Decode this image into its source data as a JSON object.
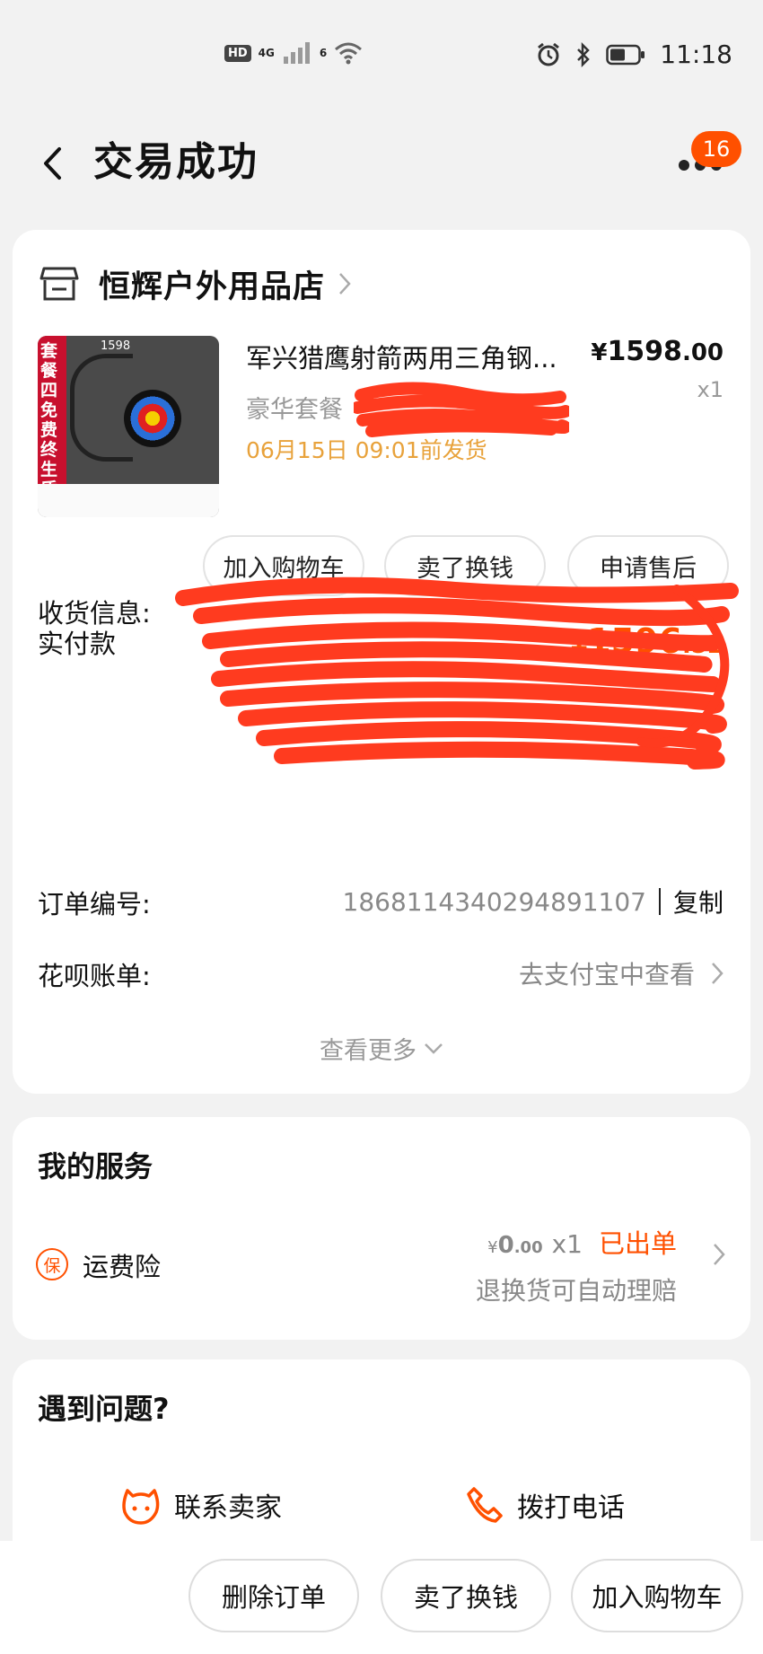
{
  "status_bar": {
    "hd": "HD",
    "net1": "4G",
    "net2": "6",
    "time": "11:18"
  },
  "nav": {
    "title": "交易成功",
    "badge": "16"
  },
  "shop": {
    "name": "恒辉户外用品店"
  },
  "product": {
    "title": "军兴猎鹰射箭两用三角钢...",
    "price_yen": "¥",
    "price_int": "1598",
    "price_dec": ".00",
    "qty": "x1",
    "spec": "豪华套餐",
    "ship": "06月15日 09:01前发货",
    "thumb_label": "套餐四免费终生质保",
    "thumb_price": "1598"
  },
  "actions": {
    "add_cart": "加入购物车",
    "sell": "卖了换钱",
    "after_sale": "申请售后"
  },
  "payment": {
    "label": "实付款",
    "yen": "¥",
    "int": "1596",
    "dec": ".52"
  },
  "shipping_info": {
    "label": "收货信息:"
  },
  "order": {
    "label": "订单编号:",
    "number": "1868114340294891107",
    "copy": "复制"
  },
  "huabei": {
    "label": "花呗账单:",
    "value": "去支付宝中查看"
  },
  "see_more": "查看更多",
  "services": {
    "title": "我的服务",
    "icon_char": "保",
    "name": "运费险",
    "yen": "¥",
    "amount": "0",
    "cents": ".00",
    "qty": "x1",
    "status": "已出单",
    "sub": "退换货可自动理赔"
  },
  "help": {
    "title": "遇到问题?",
    "contact": "联系卖家",
    "call": "拨打电话"
  },
  "bottom": {
    "delete": "删除订单",
    "sell": "卖了换钱",
    "add_cart": "加入购物车"
  },
  "colors": {
    "accent": "#ff5000",
    "ship_text": "#e8a23b",
    "redaction": "#ff3b1f"
  }
}
